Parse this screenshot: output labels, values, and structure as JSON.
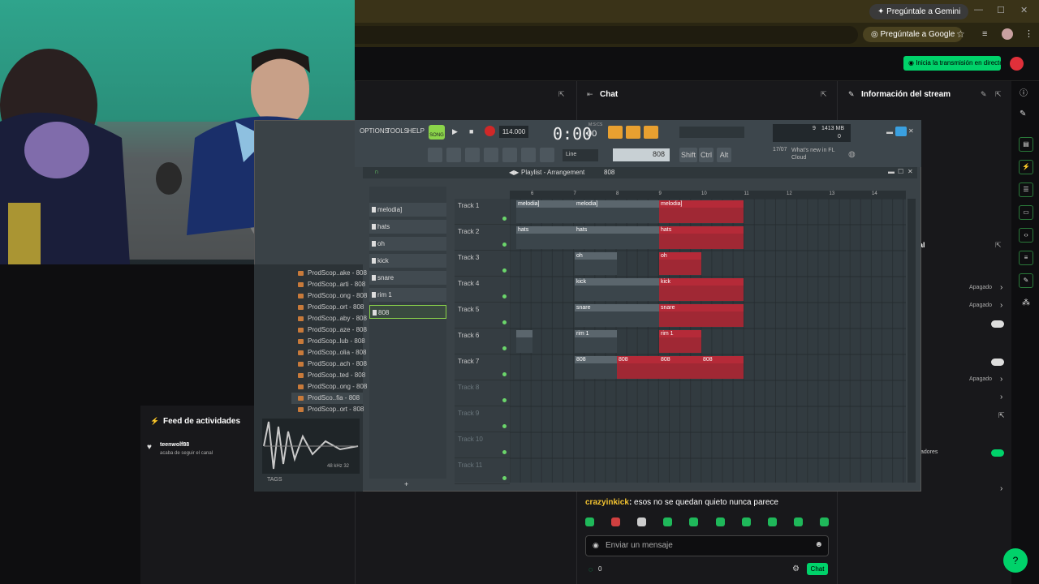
{
  "browser": {
    "gemini_label": "Pregúntale a Gemini",
    "google_label": "Pregúntale a Google"
  },
  "twitch": {
    "golive_label": "Inicia la transmisión en directo",
    "chat_title": "Chat",
    "stream_info_title": "Información del stream",
    "activity_title": "Feed de actividades",
    "activity_user": "teenwolf88",
    "activity_text": "acaba de seguir el canal",
    "chat_user": "crazyinkick",
    "chat_text": "esos no se quedan quieto nunca parece",
    "chat_placeholder": "Enviar un mensaje",
    "chat_button": "Chat",
    "points": "0",
    "settings": [
      {
        "value": "Apagado"
      },
      {
        "value": "Apagado"
      },
      {
        "value": "Apagado"
      }
    ],
    "partial_label": "al",
    "partial_label2": "adores"
  },
  "fl": {
    "menu": [
      "OPTIONS",
      "TOOLS",
      "HELP"
    ],
    "mode": "SONG",
    "tempo": "114.000",
    "time": "0:00",
    "time_ms": "00",
    "time_small": "M:S:CS",
    "pattern": "808",
    "snap": "Line",
    "memory": "1413 MB",
    "cpu": "9",
    "poly": "0",
    "news_date": "17/07",
    "news_text": "What's new in FL Cloud",
    "playlist_title": "Playlist - Arrangement",
    "playlist_pattern": "808",
    "keys": [
      "Shift",
      "Ctrl",
      "Alt"
    ],
    "ruler": [
      "6",
      "7",
      "8",
      "9",
      "10",
      "11",
      "12",
      "13",
      "14"
    ],
    "patterns": [
      "melodia]",
      "hats",
      "oh",
      "kick",
      "snare",
      "rim 1",
      "808"
    ],
    "tracks": [
      "Track 1",
      "Track 2",
      "Track 3",
      "Track 4",
      "Track 5",
      "Track 6",
      "Track 7",
      "Track 8",
      "Track 9",
      "Track 10",
      "Track 11"
    ],
    "browser_items": [
      "ProdScop..ake - 808",
      "ProdScop..arti - 808",
      "ProdScop..ong - 808",
      "ProdScop..ort - 808",
      "ProdScop..aby - 808",
      "ProdScop..aze - 808",
      "ProdScop..lub - 808",
      "ProdScop..olia - 808",
      "ProdScop..ach - 808",
      "ProdScop..ted - 808",
      "ProdScop..ong - 808",
      "ProdSco..fia - 808",
      "ProdScop..ort - 808"
    ],
    "sample_info": "48 kHz 32",
    "tags_label": "TAGS"
  }
}
